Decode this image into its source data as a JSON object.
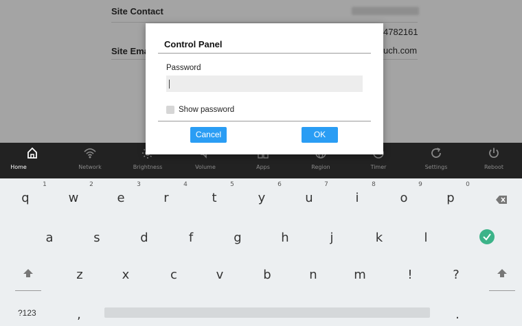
{
  "background": {
    "site_contact_label": "Site Contact",
    "site_email_label": "Site Ema",
    "phone_value": "4782161",
    "email_value": "uch.com"
  },
  "navbar": {
    "items": [
      {
        "label": "Home",
        "icon": "home-icon"
      },
      {
        "label": "Network",
        "icon": "wifi-icon"
      },
      {
        "label": "Brightness",
        "icon": "brightness-icon"
      },
      {
        "label": "Volume",
        "icon": "volume-icon"
      },
      {
        "label": "Apps",
        "icon": "apps-icon"
      },
      {
        "label": "Region",
        "icon": "globe-icon"
      },
      {
        "label": "Timer",
        "icon": "timer-icon"
      },
      {
        "label": "Settings",
        "icon": "refresh-icon"
      },
      {
        "label": "Reboot",
        "icon": "power-icon"
      }
    ],
    "active": "Home"
  },
  "dialog": {
    "title": "Control Panel",
    "password_label": "Password",
    "password_value": "",
    "show_password_label": "Show password",
    "show_password_checked": false,
    "cancel_label": "Cancel",
    "ok_label": "OK"
  },
  "keyboard": {
    "row1": [
      "q",
      "w",
      "e",
      "r",
      "t",
      "y",
      "u",
      "i",
      "o",
      "p"
    ],
    "row1_hints": [
      "1",
      "2",
      "3",
      "4",
      "5",
      "6",
      "7",
      "8",
      "9",
      "0"
    ],
    "row2": [
      "a",
      "s",
      "d",
      "f",
      "g",
      "h",
      "j",
      "k",
      "l"
    ],
    "row3": [
      "z",
      "x",
      "c",
      "v",
      "b",
      "n",
      "m",
      "!",
      "?"
    ],
    "symbols_label": "?123",
    "comma": ",",
    "period": "."
  },
  "colors": {
    "accent": "#2a9df4",
    "enter": "#3cb389",
    "navbar_bg": "#222222"
  }
}
